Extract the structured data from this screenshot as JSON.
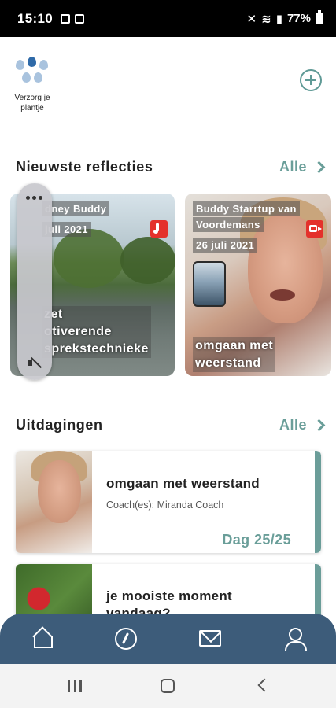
{
  "status_bar": {
    "time": "15:10",
    "battery": "77%"
  },
  "header": {
    "logo_text": "Verzorg je plantje"
  },
  "reflections": {
    "title": "Nieuwste reflecties",
    "all_label": "Alle",
    "cards": [
      {
        "author": "dney Buddy",
        "date": "juli 2021",
        "caption_lines": [
          "zet",
          "otiverende",
          "sprekstechnieke"
        ],
        "media": "music"
      },
      {
        "author_lines": [
          "Buddy Starrtup van",
          "Voordemans"
        ],
        "date": "26 juli 2021",
        "caption_lines": [
          "omgaan met",
          "weerstand"
        ],
        "media": "video"
      }
    ]
  },
  "challenges": {
    "title": "Uitdagingen",
    "all_label": "Alle",
    "items": [
      {
        "title": "omgaan met weerstand",
        "coach": "Coach(es): Miranda Coach",
        "progress": "Dag 25/25"
      },
      {
        "title_lines": [
          "je mooiste moment",
          "vandaag?"
        ]
      }
    ]
  },
  "bottom_nav": [
    "home-icon",
    "compass-icon",
    "mail-icon",
    "user-icon"
  ],
  "colors": {
    "accent": "#6a9e99",
    "nav": "#3d5c7a",
    "badge": "#e4312b"
  }
}
